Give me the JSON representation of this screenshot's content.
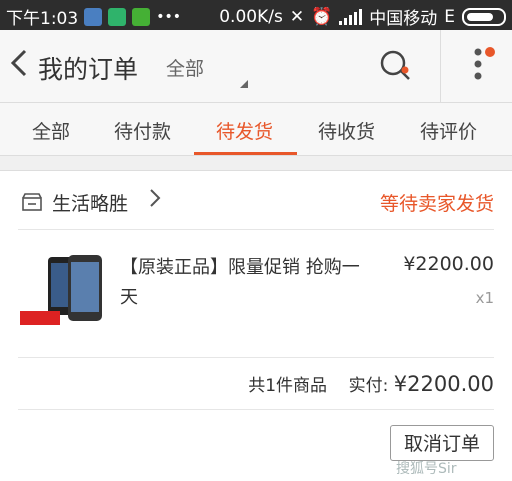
{
  "status_bar": {
    "time": "下午1:03",
    "speed": "0.00K/s",
    "carrier": "中国移动",
    "network": "E"
  },
  "header": {
    "back_icon": "chevron-left-icon",
    "title": "我的订单",
    "filter": "全部",
    "search_icon": "search-icon",
    "more_icon": "more-vertical-icon"
  },
  "tabs": [
    {
      "label": "全部"
    },
    {
      "label": "待付款"
    },
    {
      "label": "待发货",
      "active": true
    },
    {
      "label": "待收货"
    },
    {
      "label": "待评价"
    }
  ],
  "order": {
    "shop_name": "生活略胜",
    "status": "等待卖家发货",
    "product": {
      "title": "【原装正品】限量促销 抢购一天",
      "price": "¥2200.00",
      "quantity": "x1"
    },
    "summary_count": "共1件商品",
    "summary_label": "实付:",
    "summary_amount": "¥2200.00",
    "cancel_label": "取消订单"
  },
  "watermark": "搜狐号Sir",
  "colors": {
    "accent": "#e8572a",
    "status_bar_bg": "#2d2d2d",
    "header_bg": "#f7f7f7"
  }
}
